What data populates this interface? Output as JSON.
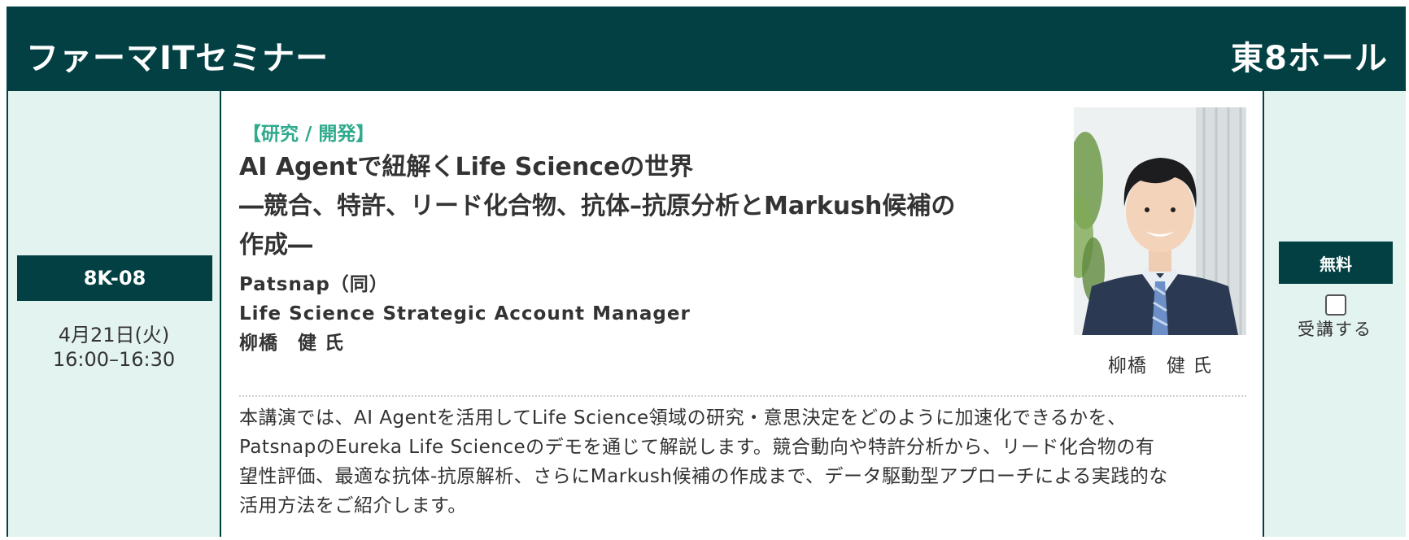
{
  "header": {
    "title": "ファーマITセミナー",
    "hall": "東8ホール",
    "bg_color": "#024043"
  },
  "session": {
    "code": "8K-08",
    "date": "4月21日(火)",
    "time": "16:00–16:30"
  },
  "content": {
    "category": "【研究 / 開発】",
    "title_lines": [
      "AI Agentで紐解くLife Scienceの世界",
      "―競合、特許、リード化合物、抗体–抗原分析とMarkush候補の",
      "作成―"
    ],
    "speaker_lines": [
      "Patsnap（同）",
      "Life Science Strategic Account Manager",
      "柳橋　健 氏"
    ],
    "photo_caption": "柳橋　健 氏",
    "description_lines": [
      "本講演では、AI Agentを活用してLife Science領域の研究・意思決定をどのように加速化できるかを、",
      "PatsnapのEureka Life Scienceのデモを通じて解説します。競合動向や特許分析から、リード化合物の有",
      "望性評価、最適な抗体-抗原解析、さらにMarkush候補の作成まで、データ駆動型アプローチによる実践的な",
      "活用方法をご紹介します。"
    ],
    "accent_color": "#2eaa8c"
  },
  "registration": {
    "price": "無料",
    "attend_label": "受講する",
    "checked": false
  }
}
